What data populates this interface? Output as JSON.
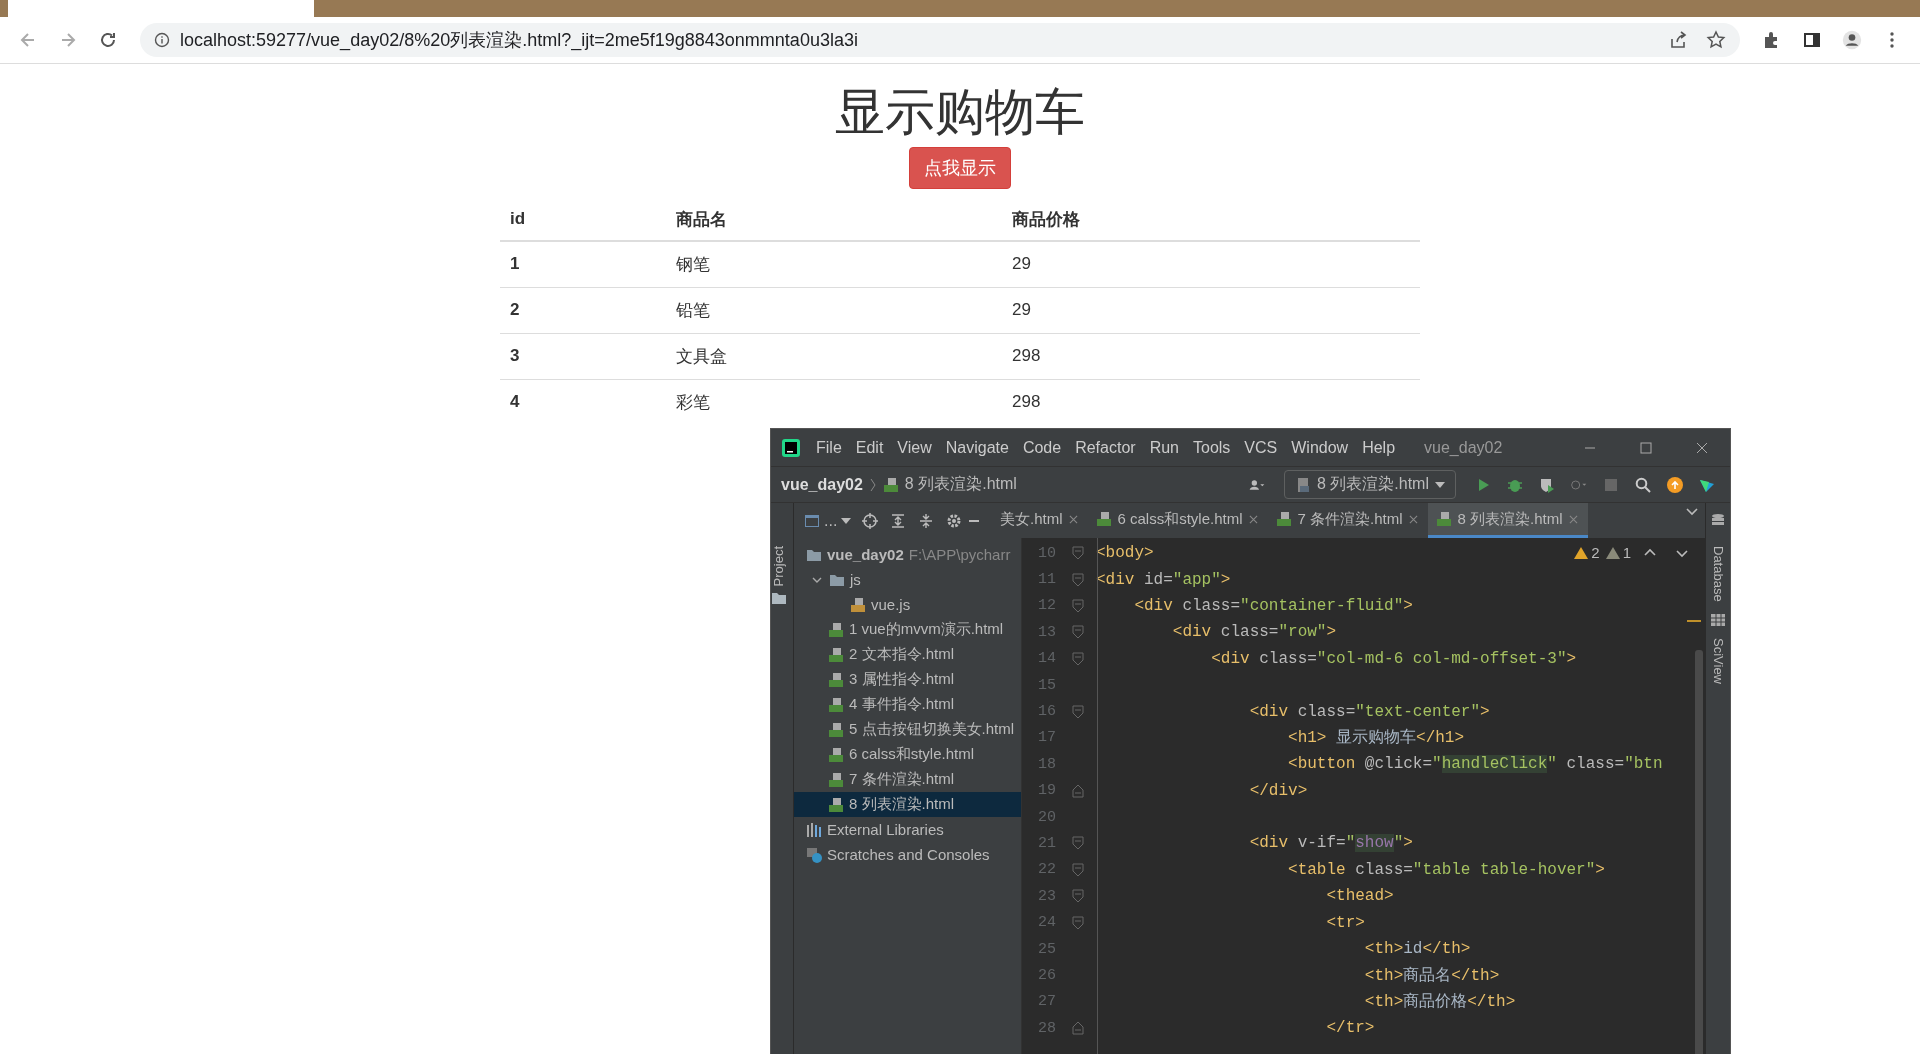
{
  "browser": {
    "url": "localhost:59277/vue_day02/8%20列表渲染.html?_ijt=2me5f19g8843onmmnta0u3la3i"
  },
  "page": {
    "title": "显示购物车",
    "button": "点我显示",
    "table": {
      "columns": [
        "id",
        "商品名",
        "商品价格"
      ],
      "rows": [
        [
          "1",
          "钢笔",
          "29"
        ],
        [
          "2",
          "铅笔",
          "29"
        ],
        [
          "3",
          "文具盒",
          "298"
        ],
        [
          "4",
          "彩笔",
          "298"
        ]
      ]
    }
  },
  "ide": {
    "menu": [
      "File",
      "Edit",
      "View",
      "Navigate",
      "Code",
      "Refactor",
      "Run",
      "Tools",
      "VCS",
      "Window",
      "Help"
    ],
    "title": "vue_day02",
    "breadcrumb": {
      "project": "vue_day02",
      "file": "8 列表渲染.html"
    },
    "run_config": "8 列表渲染.html",
    "left_panel_tab": "Project",
    "right_panel_tabs": [
      "Database",
      "SciView"
    ],
    "view_selector": "...",
    "tabs": [
      {
        "label": "美女.html",
        "selected": false
      },
      {
        "label": "6 calss和style.html",
        "selected": false
      },
      {
        "label": "7 条件渲染.html",
        "selected": false
      },
      {
        "label": "8 列表渲染.html",
        "selected": true
      }
    ],
    "inspections": {
      "warnings": "2",
      "weak_warnings": "1"
    },
    "tree": [
      {
        "label": "vue_day02",
        "path": "F:\\APP\\pycharr",
        "kind": "root",
        "selected": false,
        "children": [
          {
            "label": "js",
            "kind": "folder",
            "expanded": true,
            "selected": false,
            "children": [
              {
                "label": "vue.js",
                "kind": "js",
                "selected": false
              }
            ]
          },
          {
            "label": "1 vue的mvvm演示.html",
            "kind": "html",
            "selected": false
          },
          {
            "label": "2 文本指令.html",
            "kind": "html",
            "selected": false
          },
          {
            "label": "3 属性指令.html",
            "kind": "html",
            "selected": false
          },
          {
            "label": "4 事件指令.html",
            "kind": "html",
            "selected": false
          },
          {
            "label": "5 点击按钮切换美女.html",
            "kind": "html",
            "selected": false
          },
          {
            "label": "6 calss和style.html",
            "kind": "html",
            "selected": false
          },
          {
            "label": "7 条件渲染.html",
            "kind": "html",
            "selected": false
          },
          {
            "label": "8 列表渲染.html",
            "kind": "html",
            "selected": true
          }
        ]
      },
      {
        "label": "External Libraries",
        "kind": "libraries",
        "selected": false
      },
      {
        "label": "Scratches and Consoles",
        "kind": "scratches",
        "selected": false
      }
    ],
    "code": [
      {
        "number": "10",
        "kind": "fold_start",
        "tokens": [
          {
            "kind": "tag",
            "text": "<body>"
          }
        ]
      },
      {
        "number": "11",
        "kind": "fold_start",
        "tokens": [
          {
            "kind": "tag",
            "text": "<div"
          },
          {
            "kind": "attr",
            "text": " id="
          },
          {
            "kind": "str",
            "text": "\"app\""
          },
          {
            "kind": "tag",
            "text": ">"
          }
        ]
      },
      {
        "number": "12",
        "kind": "fold_start",
        "tokens": [
          {
            "kind": "tag",
            "text": "    <div"
          },
          {
            "kind": "attr",
            "text": " class="
          },
          {
            "kind": "str",
            "text": "\"container-fluid\""
          },
          {
            "kind": "tag",
            "text": ">"
          }
        ]
      },
      {
        "number": "13",
        "kind": "fold_start",
        "tokens": [
          {
            "kind": "tag",
            "text": "        <div"
          },
          {
            "kind": "attr",
            "text": " class="
          },
          {
            "kind": "str",
            "text": "\"row\""
          },
          {
            "kind": "tag",
            "text": ">"
          }
        ]
      },
      {
        "number": "14",
        "kind": "fold_start",
        "tokens": [
          {
            "kind": "tag",
            "text": "            <div"
          },
          {
            "kind": "attr",
            "text": " class="
          },
          {
            "kind": "str",
            "text": "\"col-md-6 col-md-offset-3\""
          },
          {
            "kind": "tag",
            "text": ">"
          }
        ]
      },
      {
        "number": "15"
      },
      {
        "number": "16",
        "kind": "fold_start",
        "tokens": [
          {
            "kind": "tag",
            "text": "                <div"
          },
          {
            "kind": "attr",
            "text": " class="
          },
          {
            "kind": "str",
            "text": "\"text-center\""
          },
          {
            "kind": "tag",
            "text": ">"
          }
        ]
      },
      {
        "number": "17",
        "tokens": [
          {
            "kind": "tag",
            "text": "                    <h1>"
          },
          {
            "kind": "text",
            "text": " 显示购物车"
          },
          {
            "kind": "tag",
            "text": "</h1>"
          }
        ]
      },
      {
        "number": "18",
        "tokens": [
          {
            "kind": "tag",
            "text": "                    <button"
          },
          {
            "kind": "attr",
            "text": " @click="
          },
          {
            "kind": "str",
            "text": "\""
          },
          {
            "kind": "match",
            "text": "handleClick"
          },
          {
            "kind": "str",
            "text": "\""
          },
          {
            "kind": "attr",
            "text": " class="
          },
          {
            "kind": "str",
            "text": "\"btn"
          }
        ]
      },
      {
        "number": "19",
        "kind": "fold_end",
        "tokens": [
          {
            "kind": "tag",
            "text": "                </div>"
          }
        ]
      },
      {
        "number": "20"
      },
      {
        "number": "21",
        "kind": "fold_start",
        "tokens": [
          {
            "kind": "tag",
            "text": "                <div"
          },
          {
            "kind": "attr",
            "text": " v-if="
          },
          {
            "kind": "str",
            "text": "\""
          },
          {
            "kind": "ref",
            "text": "show"
          },
          {
            "kind": "str",
            "text": "\""
          },
          {
            "kind": "tag",
            "text": ">"
          }
        ]
      },
      {
        "number": "22",
        "kind": "fold_start",
        "tokens": [
          {
            "kind": "tag",
            "text": "                    <table"
          },
          {
            "kind": "attr",
            "text": " class="
          },
          {
            "kind": "str",
            "text": "\"table table-hover\""
          },
          {
            "kind": "tag",
            "text": ">"
          }
        ]
      },
      {
        "number": "23",
        "kind": "fold_start",
        "tokens": [
          {
            "kind": "tag",
            "text": "                        <thead>"
          }
        ]
      },
      {
        "number": "24",
        "kind": "fold_start",
        "tokens": [
          {
            "kind": "tag",
            "text": "                        <tr>"
          }
        ]
      },
      {
        "number": "25",
        "tokens": [
          {
            "kind": "tag",
            "text": "                            <th>"
          },
          {
            "kind": "text",
            "text": "id"
          },
          {
            "kind": "tag",
            "text": "</th>"
          }
        ]
      },
      {
        "number": "26",
        "tokens": [
          {
            "kind": "tag",
            "text": "                            <th>"
          },
          {
            "kind": "text",
            "text": "商品名"
          },
          {
            "kind": "tag",
            "text": "</th>"
          }
        ]
      },
      {
        "number": "27",
        "tokens": [
          {
            "kind": "tag",
            "text": "                            <th>"
          },
          {
            "kind": "text",
            "text": "商品价格"
          },
          {
            "kind": "tag",
            "text": "</th>"
          }
        ]
      },
      {
        "number": "28",
        "kind": "fold_end",
        "tokens": [
          {
            "kind": "tag",
            "text": "                        </tr>"
          }
        ]
      }
    ]
  }
}
